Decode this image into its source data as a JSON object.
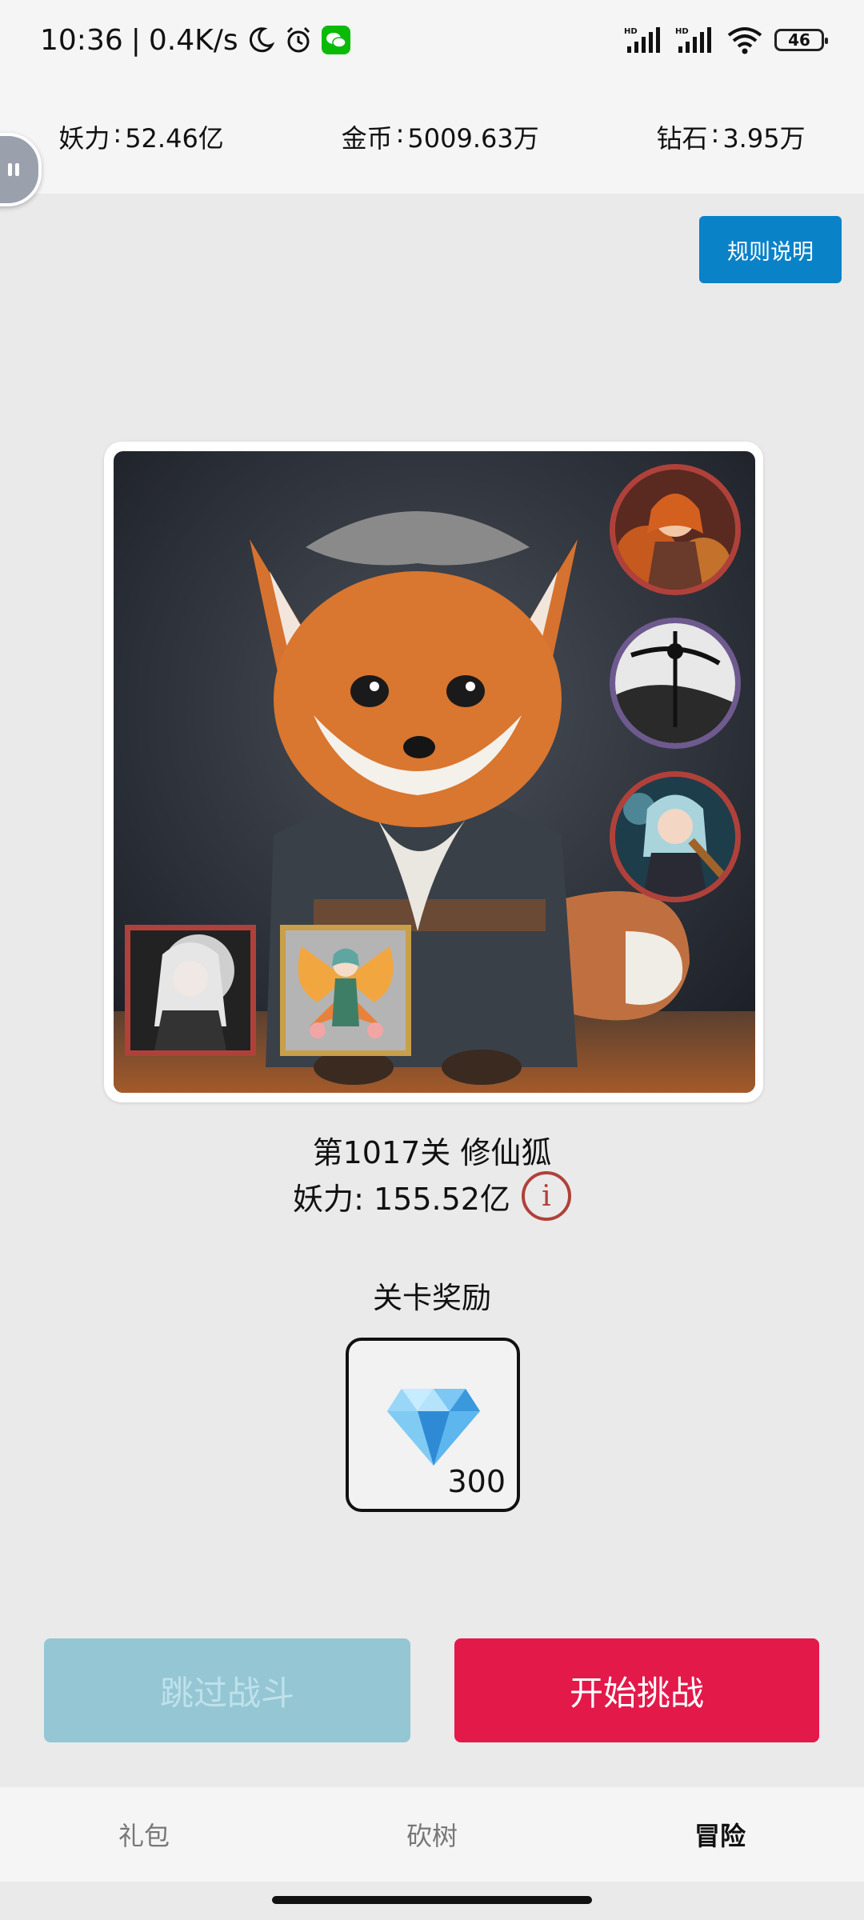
{
  "status_bar": {
    "time": "10:36",
    "separator": "|",
    "net_speed": "0.4K/s",
    "battery": "46"
  },
  "resources": [
    {
      "label": "妖力",
      "sep": ":",
      "value": "52.46亿"
    },
    {
      "label": "金币",
      "sep": ":",
      "value": "5009.63万"
    },
    {
      "label": "钻石",
      "sep": ":",
      "value": "3.95万"
    }
  ],
  "rules_button": "规则说明",
  "stage": {
    "title": "第1017关 修仙狐",
    "power_label": "妖力",
    "power_sep": ":",
    "power_value": "155.52亿",
    "info_glyph": "i"
  },
  "reward": {
    "label": "关卡奖励",
    "icon": "diamond-icon",
    "quantity": "300"
  },
  "buttons": {
    "skip": "跳过战斗",
    "start": "开始挑战"
  },
  "tabs": [
    {
      "label": "礼包",
      "active": false
    },
    {
      "label": "砍树",
      "active": false
    },
    {
      "label": "冒险",
      "active": true
    }
  ],
  "colors": {
    "accent_blue": "#0a82c8",
    "start_red": "#e3194a",
    "skip_disabled": "#95c6d4",
    "frame_red": "#b0413a",
    "frame_purple": "#6e5a8f",
    "frame_gold": "#c8a04a"
  }
}
